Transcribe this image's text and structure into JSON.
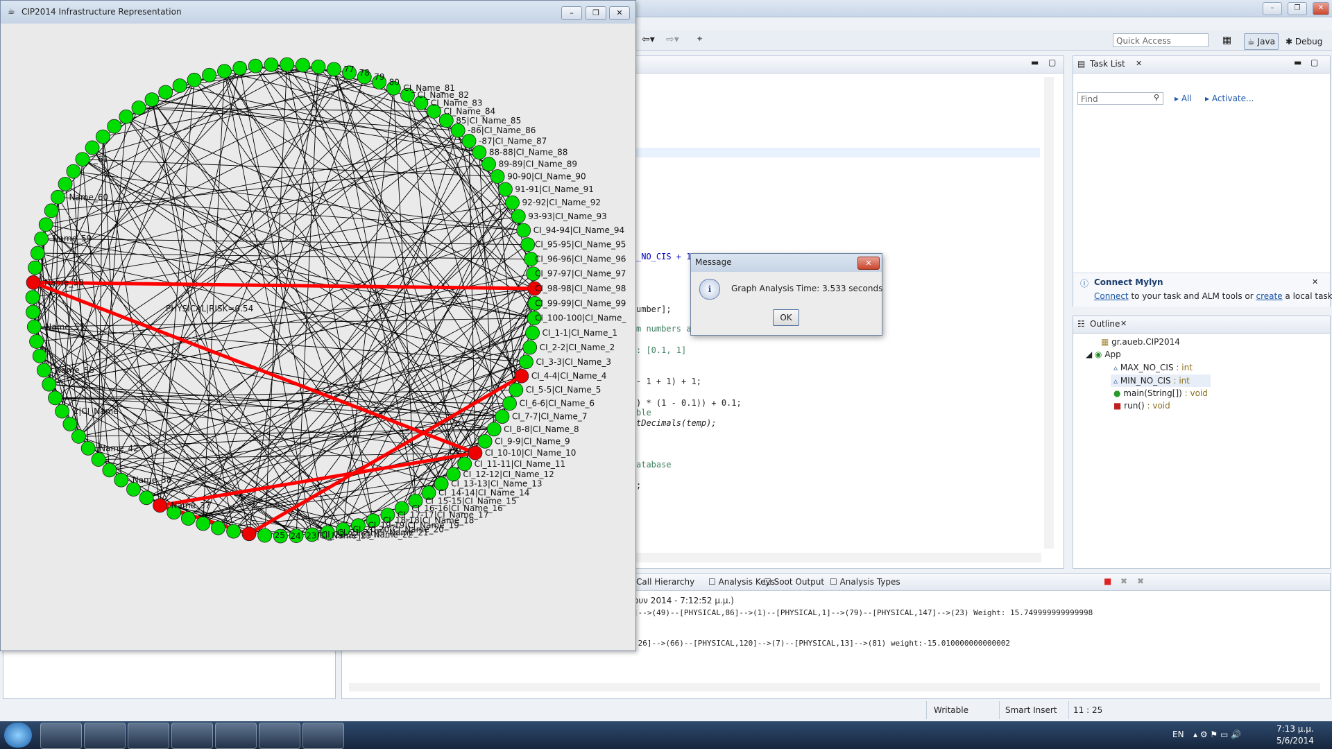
{
  "eclipse": {
    "quick_access": "Quick Access",
    "perspectives": [
      "Java",
      "Debug"
    ],
    "task_list": {
      "tab": "Task List",
      "find_placeholder": "Find",
      "all": "All",
      "activate": "Activate...",
      "connect_title": "Connect Mylyn",
      "connect_link": "Connect",
      "connect_text1": " to your task and ALM tools or ",
      "connect_create": "create",
      "connect_text2": " a local task."
    },
    "outline": {
      "tab": "Outline",
      "package": "gr.aueb.CIP2014",
      "class": "App",
      "members": [
        {
          "name": "MAX_NO_CIS",
          "type": " : int"
        },
        {
          "name": "MIN_NO_CIS",
          "type": " : int"
        },
        {
          "name": "main(String[])",
          "type": " : void"
        },
        {
          "name": "run()",
          "type": " : void"
        }
      ]
    },
    "code_lines": [
      "_NO_CIS + 1",
      "umber];",
      "m numbers a",
      ": [0.1, 1]",
      "- 1 + 1) + 1;",
      ") * (1 - 0.1)) + 0.1;",
      "ble",
      "tDecimals(temp);",
      "atabase",
      ";"
    ],
    "bottom_tabs": [
      "Call Hierarchy",
      "Analysis Keys",
      "Soot Output",
      "Analysis Types"
    ],
    "console_header": "ουν 2014 - 7:12:52 μ.μ.)",
    "console_lines": [
      "]-->(49)--[PHYSICAL,86]-->(1)--[PHYSICAL,1]-->(79)--[PHYSICAL,147]-->(23) Weight: 15.749999999999998",
      ",26]-->(66)--[PHYSICAL,120]-->(7)--[PHYSICAL,13]-->(81) weight:-15.010000000000002"
    ],
    "status": {
      "writable": "Writable",
      "insert": "Smart Insert",
      "position": "11 : 25"
    }
  },
  "graph_window": {
    "title": "CIP2014 Infrastructure Representation",
    "edge_label_sample": "PHYSICAL|RISK=0.54",
    "labels_right": [
      "77",
      "78",
      "79",
      "80",
      "CI_Name_81",
      "CI_Name_82",
      "CI_Name_83",
      "CI_Name_84",
      "85|CI_Name_85",
      "-86|CI_Name_86",
      "-87|CI_Name_87",
      "88-88|CI_Name_88",
      "89-89|CI_Name_89",
      "90-90|CI_Name_90",
      "91-91|CI_Name_91",
      "92-92|CI_Name_92",
      "93-93|CI_Name_93",
      "CI_94-94|CI_Name_94",
      "CI_95-95|CI_Name_95",
      "CI_96-96|CI_Name_96",
      "CI_97-97|CI_Name_97",
      "CI_98-98|CI_Name_98",
      "CI_99-99|CI_Name_99",
      "CI_100-100|CI_Name_",
      "CI_1-1|CI_Name_1",
      "CI_2-2|CI_Name_2",
      "CI_3-3|CI_Name_3",
      "CI_4-4|CI_Name_4",
      "CI_5-5|CI_Name_5",
      "CI_6-6|CI_Name_6",
      "CI_7-7|CI_Name_7",
      "CI_8-8|CI_Name_8",
      "CI_9-9|CI_Name_9",
      "CI_10-10|CI_Name_10",
      "CI_11-11|CI_Name_11",
      "CI_12-12|CI_Name_12",
      "CI_13-13|CI_Name_13",
      "CI_14-14|CI_Name_14",
      "CI_15-15|CI_Name_15",
      "CI_16-16|CI_Name_16",
      "CI_17-17|CI_Name_17",
      "CI_18-18|CI_Name_18",
      "CI_19-19|CI_Name_19",
      "CI_20-20|CI_Name_20",
      "CI_21-21|CI_Name_21",
      "CI_22-22|CI_Name_22",
      "23|CI_Name_23",
      "24",
      "25"
    ],
    "labels_left": [
      "_61",
      "Name_60",
      "Name_59",
      "Name_58",
      "Name_57",
      "Name_55",
      "2|CI_Name",
      "Name_42",
      "Name_38",
      "Name_37"
    ],
    "node_colors": {
      "normal": "#00dd00",
      "critical": "#ee0000",
      "edge": "#000000",
      "path": "#ff0000"
    }
  },
  "message": {
    "title": "Message",
    "text": "Graph Analysis Time: 3.533 seconds",
    "ok": "OK"
  },
  "taskbar": {
    "lang": "EN",
    "time": "7:13 μ.μ.",
    "date": "5/6/2014"
  }
}
